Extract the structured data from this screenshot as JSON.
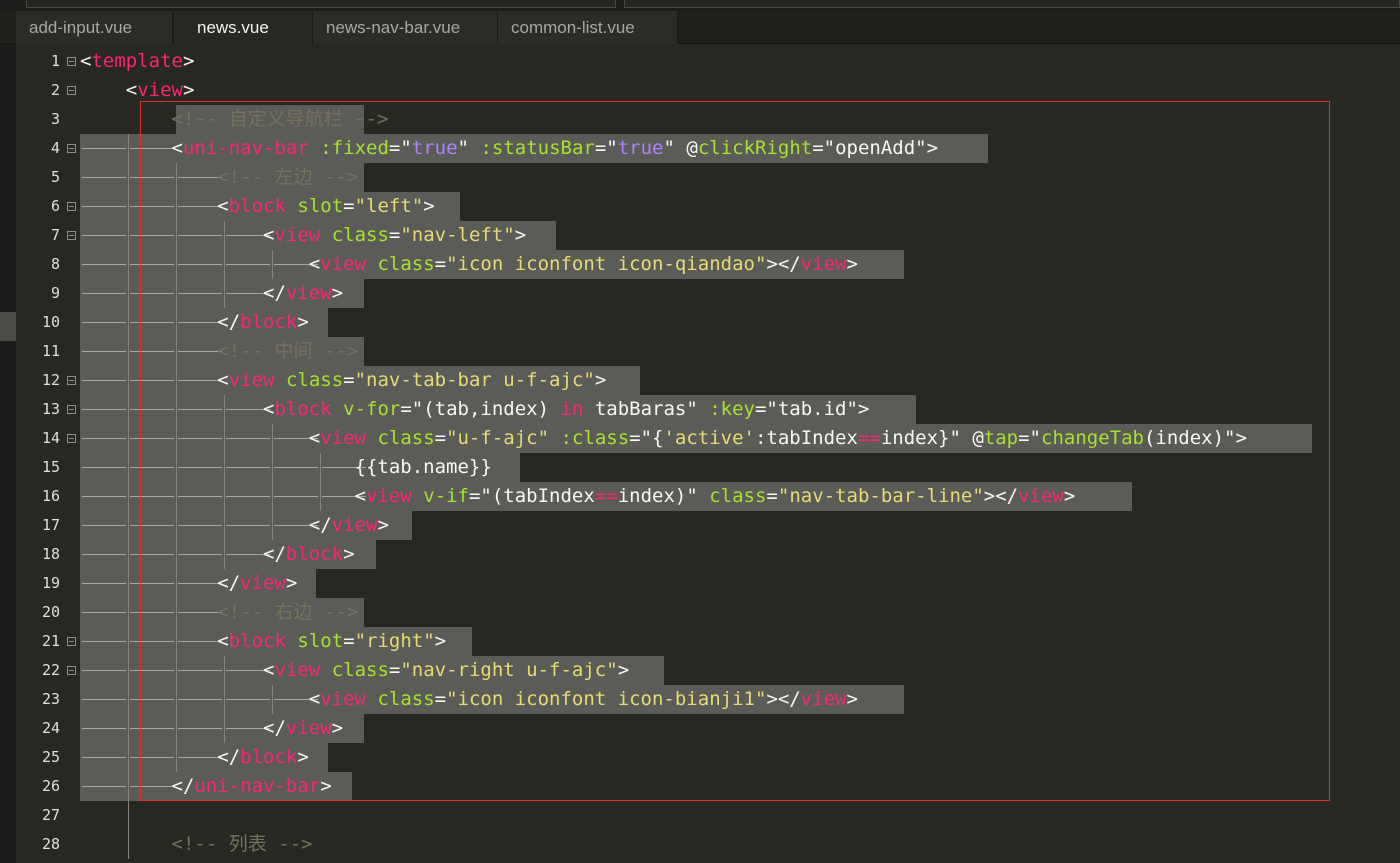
{
  "tabs": [
    {
      "label": "add-input.vue"
    },
    {
      "label": "news.vue"
    },
    {
      "label": "news-nav-bar.vue"
    },
    {
      "label": "common-list.vue"
    }
  ],
  "active_tab": 1,
  "editor": {
    "fold_icon": "fold-minus-icon",
    "selection_color": "#5b5b58",
    "highlight_box_color": "#e0302c",
    "lines": [
      {
        "n": "1",
        "fold": true,
        "segs": [
          [
            "p",
            "<"
          ],
          [
            "t",
            "template"
          ],
          [
            "p",
            ">"
          ]
        ]
      },
      {
        "n": "2",
        "fold": true,
        "segs": [
          [
            "p",
            "    <"
          ],
          [
            "t",
            "view"
          ],
          [
            "p",
            ">"
          ]
        ]
      },
      {
        "n": "3",
        "fold": false,
        "segs": [
          [
            "c",
            "        <!-- 自定义导航栏 -->"
          ]
        ]
      },
      {
        "n": "4",
        "fold": true,
        "segs": [
          [
            "p",
            "        <"
          ],
          [
            "t",
            "uni-nav-bar"
          ],
          [
            "p",
            " "
          ],
          [
            "a",
            ":fixed"
          ],
          [
            "p",
            "=\""
          ],
          [
            "v",
            "true"
          ],
          [
            "p",
            "\" "
          ],
          [
            "a",
            ":statusBar"
          ],
          [
            "p",
            "=\""
          ],
          [
            "v",
            "true"
          ],
          [
            "p",
            "\" "
          ],
          [
            "p",
            "@"
          ],
          [
            "a",
            "clickRight"
          ],
          [
            "p",
            "=\"openAdd\">"
          ]
        ]
      },
      {
        "n": "5",
        "fold": false,
        "segs": [
          [
            "c",
            "            <!-- 左边 -->"
          ]
        ]
      },
      {
        "n": "6",
        "fold": true,
        "segs": [
          [
            "p",
            "            <"
          ],
          [
            "t",
            "block"
          ],
          [
            "p",
            " "
          ],
          [
            "a",
            "slot"
          ],
          [
            "p",
            "="
          ],
          [
            "s",
            "\"left\""
          ],
          [
            "p",
            ">"
          ]
        ]
      },
      {
        "n": "7",
        "fold": true,
        "segs": [
          [
            "p",
            "                <"
          ],
          [
            "t",
            "view"
          ],
          [
            "p",
            " "
          ],
          [
            "a",
            "class"
          ],
          [
            "p",
            "="
          ],
          [
            "s",
            "\"nav-left\""
          ],
          [
            "p",
            ">"
          ]
        ]
      },
      {
        "n": "8",
        "fold": false,
        "segs": [
          [
            "p",
            "                    <"
          ],
          [
            "t",
            "view"
          ],
          [
            "p",
            " "
          ],
          [
            "a",
            "class"
          ],
          [
            "p",
            "="
          ],
          [
            "s",
            "\"icon iconfont icon-qiandao\""
          ],
          [
            "p",
            "></"
          ],
          [
            "t",
            "view"
          ],
          [
            "p",
            ">"
          ]
        ]
      },
      {
        "n": "9",
        "fold": false,
        "segs": [
          [
            "p",
            "                </"
          ],
          [
            "t",
            "view"
          ],
          [
            "p",
            ">"
          ]
        ]
      },
      {
        "n": "10",
        "fold": false,
        "segs": [
          [
            "p",
            "            </"
          ],
          [
            "t",
            "block"
          ],
          [
            "p",
            ">"
          ]
        ]
      },
      {
        "n": "11",
        "fold": false,
        "segs": [
          [
            "c",
            "            <!-- 中间 -->"
          ]
        ]
      },
      {
        "n": "12",
        "fold": true,
        "segs": [
          [
            "p",
            "            <"
          ],
          [
            "t",
            "view"
          ],
          [
            "p",
            " "
          ],
          [
            "a",
            "class"
          ],
          [
            "p",
            "="
          ],
          [
            "s",
            "\"nav-tab-bar u-f-ajc\""
          ],
          [
            "p",
            ">"
          ]
        ]
      },
      {
        "n": "13",
        "fold": true,
        "segs": [
          [
            "p",
            "                <"
          ],
          [
            "t",
            "block"
          ],
          [
            "p",
            " "
          ],
          [
            "a",
            "v-for"
          ],
          [
            "p",
            "=\"(tab,index) "
          ],
          [
            "t",
            "in"
          ],
          [
            "p",
            " tabBaras\" "
          ],
          [
            "a",
            ":key"
          ],
          [
            "p",
            "=\"tab.id\">"
          ]
        ]
      },
      {
        "n": "14",
        "fold": true,
        "segs": [
          [
            "p",
            "                    <"
          ],
          [
            "t",
            "view"
          ],
          [
            "p",
            " "
          ],
          [
            "a",
            "class"
          ],
          [
            "p",
            "="
          ],
          [
            "s",
            "\"u-f-ajc\""
          ],
          [
            "p",
            " "
          ],
          [
            "a",
            ":class"
          ],
          [
            "p",
            "=\"{"
          ],
          [
            "s",
            "'active'"
          ],
          [
            "p",
            ":tabIndex"
          ],
          [
            "t",
            "=="
          ],
          [
            "p",
            "index}\" @"
          ],
          [
            "a",
            "tap"
          ],
          [
            "p",
            "=\""
          ],
          [
            "a",
            "changeTab"
          ],
          [
            "p",
            "(index)\">"
          ]
        ]
      },
      {
        "n": "15",
        "fold": false,
        "segs": [
          [
            "p",
            "                        {{tab.name}}"
          ]
        ]
      },
      {
        "n": "16",
        "fold": false,
        "segs": [
          [
            "p",
            "                        <"
          ],
          [
            "t",
            "view"
          ],
          [
            "p",
            " "
          ],
          [
            "a",
            "v-if"
          ],
          [
            "p",
            "=\"(tabIndex"
          ],
          [
            "t",
            "=="
          ],
          [
            "p",
            "index)\" "
          ],
          [
            "a",
            "class"
          ],
          [
            "p",
            "="
          ],
          [
            "s",
            "\"nav-tab-bar-line\""
          ],
          [
            "p",
            "></"
          ],
          [
            "t",
            "view"
          ],
          [
            "p",
            ">"
          ]
        ]
      },
      {
        "n": "17",
        "fold": false,
        "segs": [
          [
            "p",
            "                    </"
          ],
          [
            "t",
            "view"
          ],
          [
            "p",
            ">"
          ]
        ]
      },
      {
        "n": "18",
        "fold": false,
        "segs": [
          [
            "p",
            "                </"
          ],
          [
            "t",
            "block"
          ],
          [
            "p",
            ">"
          ]
        ]
      },
      {
        "n": "19",
        "fold": false,
        "segs": [
          [
            "p",
            "            </"
          ],
          [
            "t",
            "view"
          ],
          [
            "p",
            ">"
          ]
        ]
      },
      {
        "n": "20",
        "fold": false,
        "segs": [
          [
            "c",
            "            <!-- 右边 -->"
          ]
        ]
      },
      {
        "n": "21",
        "fold": true,
        "segs": [
          [
            "p",
            "            <"
          ],
          [
            "t",
            "block"
          ],
          [
            "p",
            " "
          ],
          [
            "a",
            "slot"
          ],
          [
            "p",
            "="
          ],
          [
            "s",
            "\"right\""
          ],
          [
            "p",
            ">"
          ]
        ]
      },
      {
        "n": "22",
        "fold": true,
        "segs": [
          [
            "p",
            "                <"
          ],
          [
            "t",
            "view"
          ],
          [
            "p",
            " "
          ],
          [
            "a",
            "class"
          ],
          [
            "p",
            "="
          ],
          [
            "s",
            "\"nav-right u-f-ajc\""
          ],
          [
            "p",
            ">"
          ]
        ]
      },
      {
        "n": "23",
        "fold": false,
        "segs": [
          [
            "p",
            "                    <"
          ],
          [
            "t",
            "view"
          ],
          [
            "p",
            " "
          ],
          [
            "a",
            "class"
          ],
          [
            "p",
            "="
          ],
          [
            "s",
            "\"icon iconfont icon-bianji1\""
          ],
          [
            "p",
            "></"
          ],
          [
            "t",
            "view"
          ],
          [
            "p",
            ">"
          ]
        ]
      },
      {
        "n": "24",
        "fold": false,
        "segs": [
          [
            "p",
            "                </"
          ],
          [
            "t",
            "view"
          ],
          [
            "p",
            ">"
          ]
        ]
      },
      {
        "n": "25",
        "fold": false,
        "segs": [
          [
            "p",
            "            </"
          ],
          [
            "t",
            "block"
          ],
          [
            "p",
            ">"
          ]
        ]
      },
      {
        "n": "26",
        "fold": false,
        "segs": [
          [
            "p",
            "        </"
          ],
          [
            "t",
            "uni-nav-bar"
          ],
          [
            "p",
            ">"
          ]
        ]
      },
      {
        "n": "27",
        "fold": false,
        "segs": []
      },
      {
        "n": "28",
        "fold": false,
        "segs": [
          [
            "c",
            "        <!-- 列表 -->"
          ]
        ]
      }
    ]
  }
}
